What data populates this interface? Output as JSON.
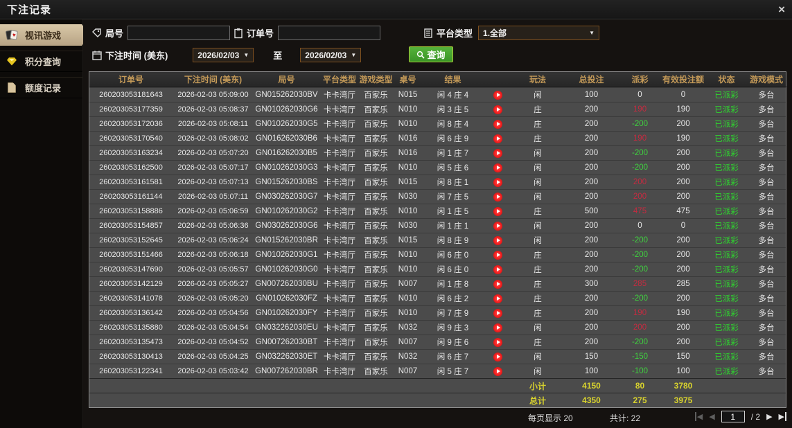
{
  "window": {
    "title": "下注记录",
    "close_glyph": "×"
  },
  "sidebar": {
    "items": [
      {
        "label": "视讯游戏",
        "icon": "cards-icon",
        "active": true
      },
      {
        "label": "积分查询",
        "icon": "gem-icon",
        "active": false
      },
      {
        "label": "额度记录",
        "icon": "document-icon",
        "active": false
      }
    ]
  },
  "filters": {
    "round_label": "局号",
    "order_label": "订单号",
    "platform_label": "平台类型",
    "platform_value": "1.全部",
    "time_label": "下注时间 (美东)",
    "date_from": "2026/02/03",
    "to_label": "至",
    "date_to": "2026/02/03",
    "search_label": "查询"
  },
  "table": {
    "headers": [
      "订单号",
      "下注时间 (美东)",
      "局号",
      "平台类型",
      "游戏类型",
      "桌号",
      "结果",
      "",
      "玩法",
      "总投注",
      "派彩",
      "有效投注额",
      "状态",
      "游戏模式"
    ],
    "rows": [
      {
        "order": "260203053181643",
        "time": "2026-02-03 05:09:00",
        "round": "GN015262030BV",
        "platform": "卡卡湾厅",
        "game": "百家乐",
        "table_no": "N015",
        "result": "闲 4 庄 4",
        "play": "闲",
        "bet": "100",
        "payout": "0",
        "valid": "0",
        "status": "已派彩",
        "mode": "多台"
      },
      {
        "order": "260203053177359",
        "time": "2026-02-03 05:08:37",
        "round": "GN010262030G6",
        "platform": "卡卡湾厅",
        "game": "百家乐",
        "table_no": "N010",
        "result": "闲 3 庄 5",
        "play": "庄",
        "bet": "200",
        "payout": "190",
        "valid": "190",
        "status": "已派彩",
        "mode": "多台"
      },
      {
        "order": "260203053172036",
        "time": "2026-02-03 05:08:11",
        "round": "GN010262030G5",
        "platform": "卡卡湾厅",
        "game": "百家乐",
        "table_no": "N010",
        "result": "闲 8 庄 4",
        "play": "庄",
        "bet": "200",
        "payout": "-200",
        "valid": "200",
        "status": "已派彩",
        "mode": "多台"
      },
      {
        "order": "260203053170540",
        "time": "2026-02-03 05:08:02",
        "round": "GN016262030B6",
        "platform": "卡卡湾厅",
        "game": "百家乐",
        "table_no": "N016",
        "result": "闲 6 庄 9",
        "play": "庄",
        "bet": "200",
        "payout": "190",
        "valid": "190",
        "status": "已派彩",
        "mode": "多台"
      },
      {
        "order": "260203053163234",
        "time": "2026-02-03 05:07:20",
        "round": "GN016262030B5",
        "platform": "卡卡湾厅",
        "game": "百家乐",
        "table_no": "N016",
        "result": "闲 1 庄 7",
        "play": "闲",
        "bet": "200",
        "payout": "-200",
        "valid": "200",
        "status": "已派彩",
        "mode": "多台"
      },
      {
        "order": "260203053162500",
        "time": "2026-02-03 05:07:17",
        "round": "GN010262030G3",
        "platform": "卡卡湾厅",
        "game": "百家乐",
        "table_no": "N010",
        "result": "闲 5 庄 6",
        "play": "闲",
        "bet": "200",
        "payout": "-200",
        "valid": "200",
        "status": "已派彩",
        "mode": "多台"
      },
      {
        "order": "260203053161581",
        "time": "2026-02-03 05:07:13",
        "round": "GN015262030BS",
        "platform": "卡卡湾厅",
        "game": "百家乐",
        "table_no": "N015",
        "result": "闲 8 庄 1",
        "play": "闲",
        "bet": "200",
        "payout": "200",
        "valid": "200",
        "status": "已派彩",
        "mode": "多台"
      },
      {
        "order": "260203053161144",
        "time": "2026-02-03 05:07:11",
        "round": "GN030262030G7",
        "platform": "卡卡湾厅",
        "game": "百家乐",
        "table_no": "N030",
        "result": "闲 7 庄 5",
        "play": "闲",
        "bet": "200",
        "payout": "200",
        "valid": "200",
        "status": "已派彩",
        "mode": "多台"
      },
      {
        "order": "260203053158886",
        "time": "2026-02-03 05:06:59",
        "round": "GN010262030G2",
        "platform": "卡卡湾厅",
        "game": "百家乐",
        "table_no": "N010",
        "result": "闲 1 庄 5",
        "play": "庄",
        "bet": "500",
        "payout": "475",
        "valid": "475",
        "status": "已派彩",
        "mode": "多台"
      },
      {
        "order": "260203053154857",
        "time": "2026-02-03 05:06:36",
        "round": "GN030262030G6",
        "platform": "卡卡湾厅",
        "game": "百家乐",
        "table_no": "N030",
        "result": "闲 1 庄 1",
        "play": "闲",
        "bet": "200",
        "payout": "0",
        "valid": "0",
        "status": "已派彩",
        "mode": "多台"
      },
      {
        "order": "260203053152645",
        "time": "2026-02-03 05:06:24",
        "round": "GN015262030BR",
        "platform": "卡卡湾厅",
        "game": "百家乐",
        "table_no": "N015",
        "result": "闲 8 庄 9",
        "play": "闲",
        "bet": "200",
        "payout": "-200",
        "valid": "200",
        "status": "已派彩",
        "mode": "多台"
      },
      {
        "order": "260203053151466",
        "time": "2026-02-03 05:06:18",
        "round": "GN010262030G1",
        "platform": "卡卡湾厅",
        "game": "百家乐",
        "table_no": "N010",
        "result": "闲 6 庄 0",
        "play": "庄",
        "bet": "200",
        "payout": "-200",
        "valid": "200",
        "status": "已派彩",
        "mode": "多台"
      },
      {
        "order": "260203053147690",
        "time": "2026-02-03 05:05:57",
        "round": "GN010262030G0",
        "platform": "卡卡湾厅",
        "game": "百家乐",
        "table_no": "N010",
        "result": "闲 6 庄 0",
        "play": "庄",
        "bet": "200",
        "payout": "-200",
        "valid": "200",
        "status": "已派彩",
        "mode": "多台"
      },
      {
        "order": "260203053142129",
        "time": "2026-02-03 05:05:27",
        "round": "GN007262030BU",
        "platform": "卡卡湾厅",
        "game": "百家乐",
        "table_no": "N007",
        "result": "闲 1 庄 8",
        "play": "庄",
        "bet": "300",
        "payout": "285",
        "valid": "285",
        "status": "已派彩",
        "mode": "多台"
      },
      {
        "order": "260203053141078",
        "time": "2026-02-03 05:05:20",
        "round": "GN010262030FZ",
        "platform": "卡卡湾厅",
        "game": "百家乐",
        "table_no": "N010",
        "result": "闲 6 庄 2",
        "play": "庄",
        "bet": "200",
        "payout": "-200",
        "valid": "200",
        "status": "已派彩",
        "mode": "多台"
      },
      {
        "order": "260203053136142",
        "time": "2026-02-03 05:04:56",
        "round": "GN010262030FY",
        "platform": "卡卡湾厅",
        "game": "百家乐",
        "table_no": "N010",
        "result": "闲 7 庄 9",
        "play": "庄",
        "bet": "200",
        "payout": "190",
        "valid": "190",
        "status": "已派彩",
        "mode": "多台"
      },
      {
        "order": "260203053135880",
        "time": "2026-02-03 05:04:54",
        "round": "GN032262030EU",
        "platform": "卡卡湾厅",
        "game": "百家乐",
        "table_no": "N032",
        "result": "闲 9 庄 3",
        "play": "闲",
        "bet": "200",
        "payout": "200",
        "valid": "200",
        "status": "已派彩",
        "mode": "多台"
      },
      {
        "order": "260203053135473",
        "time": "2026-02-03 05:04:52",
        "round": "GN007262030BT",
        "platform": "卡卡湾厅",
        "game": "百家乐",
        "table_no": "N007",
        "result": "闲 9 庄 6",
        "play": "庄",
        "bet": "200",
        "payout": "-200",
        "valid": "200",
        "status": "已派彩",
        "mode": "多台"
      },
      {
        "order": "260203053130413",
        "time": "2026-02-03 05:04:25",
        "round": "GN032262030ET",
        "platform": "卡卡湾厅",
        "game": "百家乐",
        "table_no": "N032",
        "result": "闲 6 庄 7",
        "play": "闲",
        "bet": "150",
        "payout": "-150",
        "valid": "150",
        "status": "已派彩",
        "mode": "多台"
      },
      {
        "order": "260203053122341",
        "time": "2026-02-03 05:03:42",
        "round": "GN007262030BR",
        "platform": "卡卡湾厅",
        "game": "百家乐",
        "table_no": "N007",
        "result": "闲 5 庄 7",
        "play": "闲",
        "bet": "100",
        "payout": "-100",
        "valid": "100",
        "status": "已派彩",
        "mode": "多台"
      }
    ],
    "subtotal": {
      "label": "小计",
      "bet": "4150",
      "payout": "80",
      "valid": "3780"
    },
    "total": {
      "label": "总计",
      "bet": "4350",
      "payout": "275",
      "valid": "3975"
    }
  },
  "pagination": {
    "page_size_label": "每页显示 20",
    "total_label": "共计: 22",
    "current_page": "1",
    "separator": "/",
    "total_pages": "2"
  }
}
